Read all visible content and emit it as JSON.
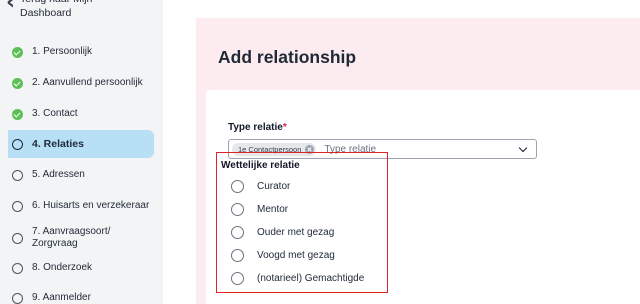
{
  "sidebar": {
    "back_label": "Terug naar Mijn Dashboard",
    "back_icon": "arrow-left-icon",
    "steps": [
      {
        "label": "1. Persoonlijk",
        "status": "done"
      },
      {
        "label": "2. Aanvullend persoonlijk",
        "status": "done"
      },
      {
        "label": "3. Contact",
        "status": "done"
      },
      {
        "label": "4. Relaties",
        "status": "current"
      },
      {
        "label": "5. Adressen",
        "status": "todo"
      },
      {
        "label": "6. Huisarts en verzekeraar",
        "status": "todo"
      },
      {
        "label": "7. Aanvraagsoort/ Zorgvraag",
        "status": "todo"
      },
      {
        "label": "8. Onderzoek",
        "status": "todo"
      },
      {
        "label": "9. Aanmelder",
        "status": "todo"
      }
    ]
  },
  "main": {
    "title": "Add relationship",
    "relation_type": {
      "label": "Type relatie",
      "required_mark": "*",
      "selected_chip": "1e Contactpersoon",
      "placeholder": "Type relatie"
    },
    "legal_relation": {
      "label": "Wettelijke relatie",
      "options": [
        "Curator",
        "Mentor",
        "Ouder met gezag",
        "Voogd met gezag",
        "(notarieel) Gemachtigde"
      ]
    }
  },
  "colors": {
    "sidebar_bg": "#f3f4f6",
    "active_step_bg": "#b7e0f6",
    "done_check": "#5cbf55",
    "main_bg": "#fdecef",
    "required": "#e11d48",
    "highlight_border": "#dc2626"
  }
}
